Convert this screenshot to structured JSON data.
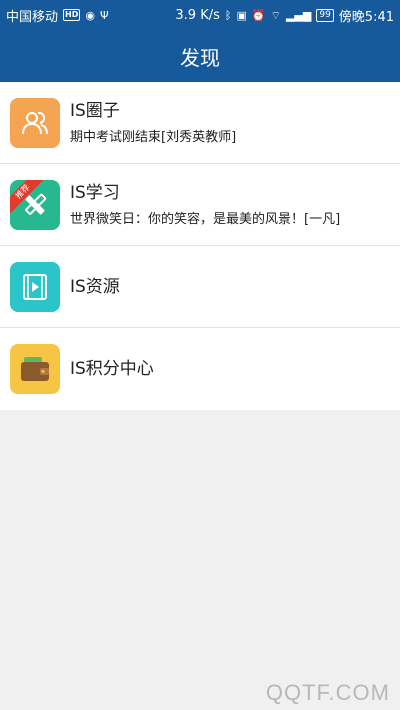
{
  "status_bar": {
    "carrier": "中国移动",
    "hd": "HD",
    "speed": "3.9 K/s",
    "battery": "99",
    "time": "傍晚5:41"
  },
  "header": {
    "title": "发现"
  },
  "items": [
    {
      "title": "IS圈子",
      "subtitle": "期中考试刚结束[刘秀英教师]",
      "icon": "users-icon",
      "color": "#f5a552"
    },
    {
      "title": "IS学习",
      "subtitle": "世界微笑日：你的笑容，是最美的风景！[一凡]",
      "icon": "pencil-ruler-icon",
      "color": "#26b88e",
      "badge": "推荐"
    },
    {
      "title": "IS资源",
      "subtitle": "",
      "icon": "video-icon",
      "color": "#29c5c9"
    },
    {
      "title": "IS积分中心",
      "subtitle": "",
      "icon": "wallet-icon",
      "color": "#f6c543"
    }
  ],
  "watermark": "QQTF.COM"
}
